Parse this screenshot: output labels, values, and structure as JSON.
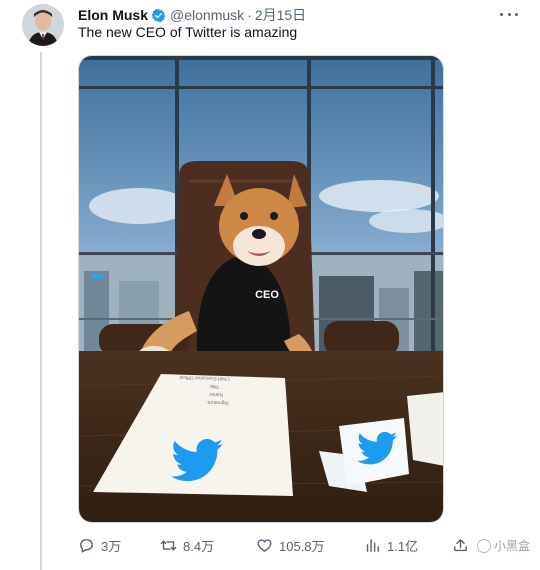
{
  "tweet": {
    "author_name": "Elon Musk",
    "handle": "@elonmusk",
    "separator": "·",
    "date": "2月15日",
    "text": "The new CEO of Twitter is amazing",
    "verified": true
  },
  "media": {
    "sweater_text": "CEO",
    "document_lines": [
      "Signature:",
      "Name:",
      "Title:",
      "Chief Executive Officer"
    ]
  },
  "actions": {
    "replies": "3万",
    "retweets": "8.4万",
    "likes": "105.8万",
    "views": "1.1亿"
  },
  "watermark": {
    "text": "小黑盒"
  },
  "colors": {
    "text_primary": "#0f1419",
    "text_secondary": "#536471",
    "verified_blue": "#1d9bf0",
    "twitter_blue": "#1d9bf0",
    "divider": "#cfd9de"
  },
  "icons": [
    "verified-badge-icon",
    "more-icon",
    "reply-icon",
    "retweet-icon",
    "like-icon",
    "views-icon",
    "share-icon"
  ]
}
